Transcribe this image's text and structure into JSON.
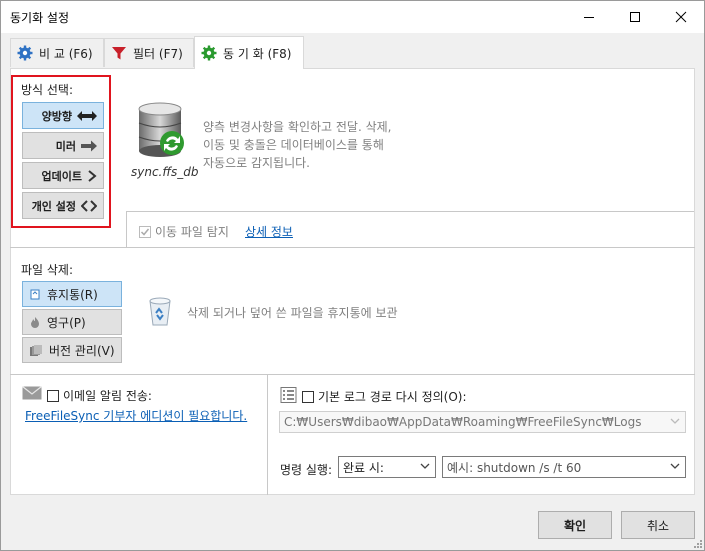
{
  "window": {
    "title": "동기화 설정"
  },
  "tabs": [
    {
      "label": "비 교 (F6)",
      "icon": "gear-blue-icon"
    },
    {
      "label": "필터 (F7)",
      "icon": "filter-funnel-icon"
    },
    {
      "label": "동 기 화 (F8)",
      "icon": "gear-green-icon"
    }
  ],
  "variant": {
    "heading": "방식 선택:",
    "options": [
      {
        "label": "양방향",
        "icon": "two-way-arrow-icon",
        "selected": true
      },
      {
        "label": "미러",
        "icon": "right-arrow-icon",
        "selected": false
      },
      {
        "label": "업데이트",
        "icon": "chevron-right-icon",
        "selected": false
      },
      {
        "label": "개인 설정",
        "icon": "angle-brackets-icon",
        "selected": false
      }
    ],
    "db_caption": "sync.ffs_db",
    "description": [
      "양측 변경사항을 확인하고 전달. 삭제,",
      "이동 및 충돌은 데이터베이스를 통해",
      "자동으로 감지됩니다."
    ],
    "detect_moved_label": "이동 파일 탐지",
    "details_link": "상세 정보"
  },
  "deletion": {
    "heading": "파일 삭제:",
    "options": [
      {
        "label": "휴지통(R)",
        "selected": true
      },
      {
        "label": "영구(P)",
        "selected": false
      },
      {
        "label": "버전 관리(V)",
        "selected": false
      }
    ],
    "description": "삭제 되거나 덮어 쓴 파일을 휴지통에 보관"
  },
  "email": {
    "label": "이메일 알림 전송:",
    "link": "FreeFileSync 기부자 에디션이 필요합니다."
  },
  "log": {
    "label": "기본 로그 경로 다시 정의(O):",
    "path": "C:₩Users₩dibao₩AppData₩Roaming₩FreeFileSync₩Logs"
  },
  "command": {
    "label": "명령 실행:",
    "when": "완료 시:",
    "placeholder": "예시: shutdown /s /t 60"
  },
  "buttons": {
    "ok": "확인",
    "cancel": "취소"
  },
  "colors": {
    "highlight_box": "#e0141e",
    "selected_bg": "#cde4f7",
    "link": "#0b5fb5"
  }
}
